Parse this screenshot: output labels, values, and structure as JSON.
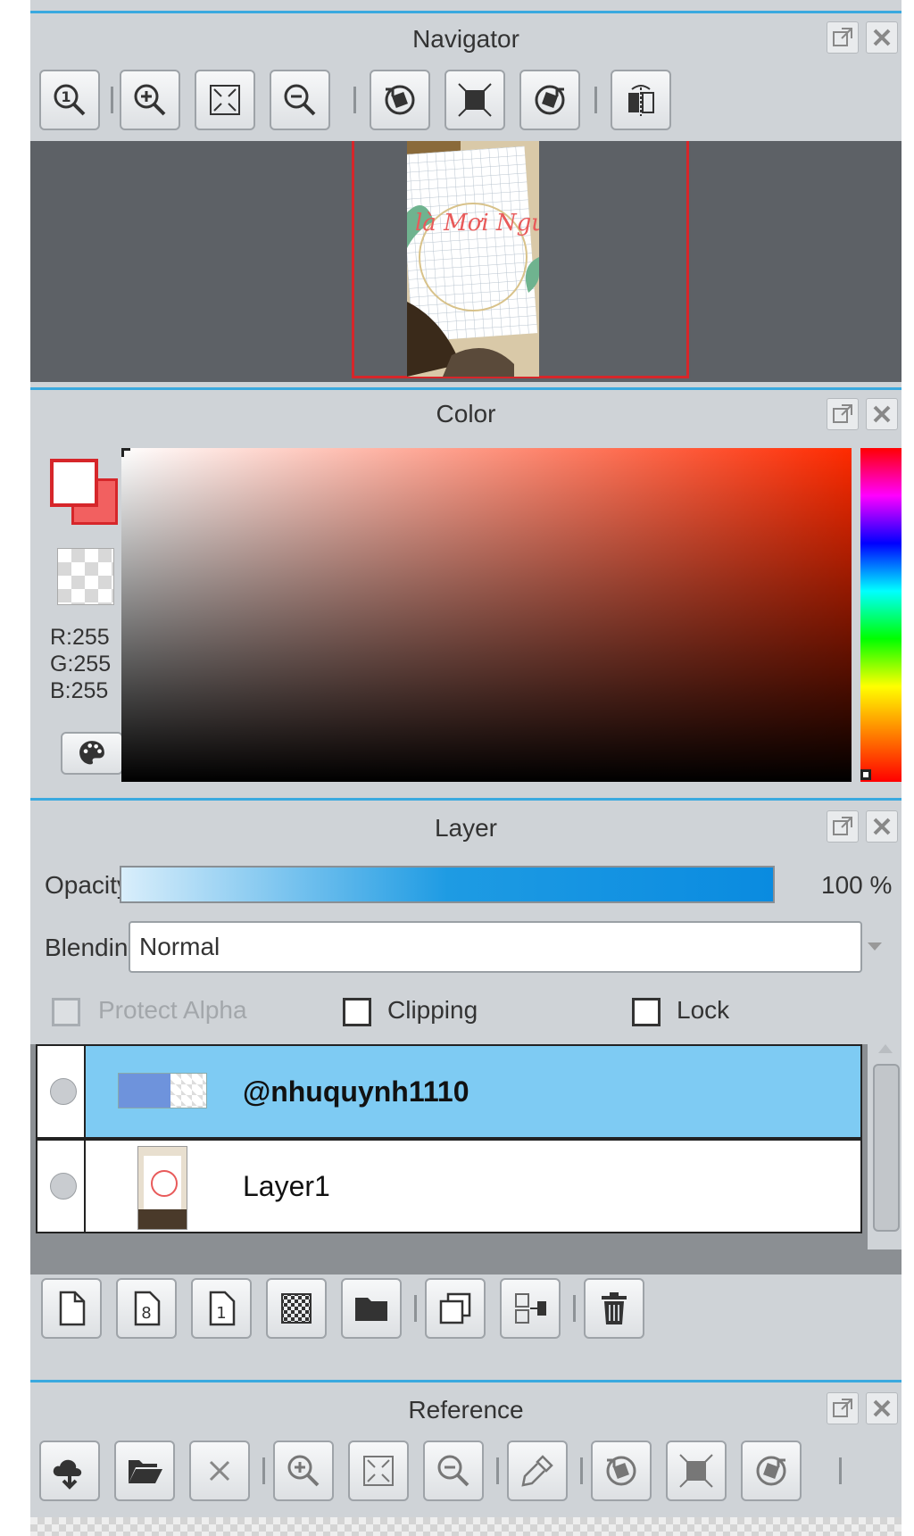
{
  "navigator": {
    "title": "Navigator",
    "tools": [
      "zoom-actual-icon",
      "zoom-in-icon",
      "fit-screen-icon",
      "zoom-out-icon",
      "rotate-left-icon",
      "reset-rotation-icon",
      "rotate-right-icon",
      "flip-horizontal-icon"
    ],
    "preview_text": "hề là Mơi Người"
  },
  "color": {
    "title": "Color",
    "r": "R:255",
    "g": "G:255",
    "b": "B:255",
    "foreground": "#ffffff",
    "background": "#f26060"
  },
  "layer": {
    "title": "Layer",
    "opacity_label": "Opacity",
    "opacity_value": "100 %",
    "opacity_fraction": 1.0,
    "blending_label": "Blending",
    "blending_value": "Normal",
    "protect_alpha_label": "Protect Alpha",
    "clipping_label": "Clipping",
    "lock_label": "Lock",
    "layers": [
      {
        "name": "@nhuquynh1110",
        "selected": true
      },
      {
        "name": "Layer1",
        "selected": false
      }
    ],
    "tools": [
      "new-layer-icon",
      "new-8bit-layer-icon",
      "new-1bit-layer-icon",
      "new-halftone-layer-icon",
      "new-folder-icon",
      "duplicate-layer-icon",
      "merge-down-icon",
      "delete-layer-icon"
    ]
  },
  "reference": {
    "title": "Reference",
    "tools": [
      "open-cloud-icon",
      "open-folder-icon",
      "close-icon",
      "zoom-in-icon",
      "fit-screen-icon",
      "zoom-out-icon",
      "eyedropper-icon",
      "rotate-left-icon",
      "reset-rotation-icon",
      "rotate-right-icon"
    ]
  },
  "colors": {
    "accent": "#3aa9df",
    "selected_row": "#7ecbf3",
    "nav_frame": "#d6262a",
    "panel": "#cfd3d7"
  }
}
